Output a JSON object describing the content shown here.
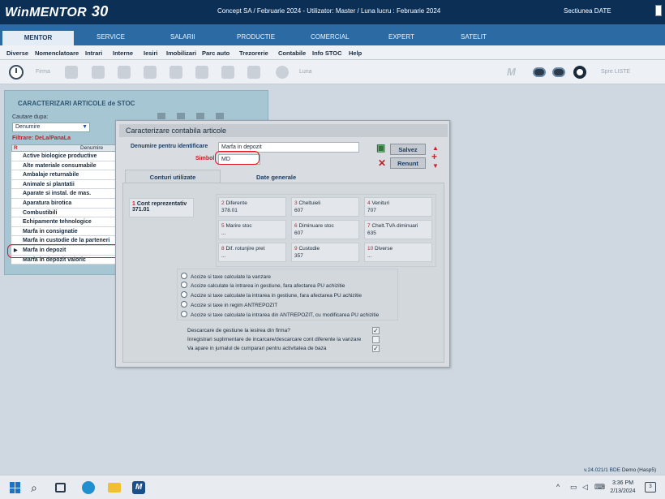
{
  "titlebar": {
    "logo": "WinMENTOR",
    "logo_version": "30",
    "center_text": "Concept SA / Februarie 2024 - Utilizator: Master / Luna lucru : Februarie 2024",
    "right_text": "Sectiunea DATE"
  },
  "module_tabs": [
    "MENTOR",
    "SERVICE",
    "SALARII",
    "PRODUCTIE",
    "COMERCIAL",
    "EXPERT",
    "SATELIT"
  ],
  "menu": [
    "Diverse",
    "Nomenclatoare",
    "Intrari",
    "Interne",
    "Iesiri",
    "Imobilizari",
    "Parc auto",
    "Trezorerie",
    "Contabile",
    "Info STOC",
    "Help"
  ],
  "toolbar": {
    "firma_label": "Firma",
    "luna_label": "Luna",
    "spre_liste_label": "Spre LISTE"
  },
  "bg_window": {
    "title": "CARACTERIZARI ARTICOLE de STOC",
    "search_label": "Cautare dupa:",
    "search_value": "Denumire",
    "filter_label": "Filtrare: DeLa/PanaLa",
    "col_r": "R",
    "col_name": "Denumire",
    "rows": [
      "Active biologice productive",
      "Alte materiale consumabile",
      "Ambalaje returnabile",
      "Animale si plantatii",
      "Aparate si instal. de mas.",
      "Aparatura birotica",
      "Combustibili",
      "Echipamente tehnologice",
      "Marfa in consignatie",
      "Marfa in custodie de la parteneri",
      "Marfa in depozit",
      "Marfa in depozit valoric"
    ]
  },
  "dialog": {
    "title": "Caracterizare contabila articole",
    "name_label": "Denumire pentru identificare",
    "name_value": "Marfa in depozit",
    "symbol_label": "Simbol",
    "symbol_value": "MD",
    "save_label": "Salvez",
    "cancel_label": "Renunt",
    "tab_accounts": "Conturi utilizate",
    "tab_general": "Date generale",
    "main_account": {
      "num": "1",
      "label": "Cont reprezentativ",
      "value": "371.01"
    },
    "accounts": [
      {
        "num": "2",
        "label": "Diferente",
        "value": "378.01"
      },
      {
        "num": "3",
        "label": "Cheltuieli",
        "value": "607"
      },
      {
        "num": "4",
        "label": "Venituri",
        "value": "707"
      },
      {
        "num": "5",
        "label": "Marire stoc",
        "value": "..."
      },
      {
        "num": "6",
        "label": "Diminuare stoc",
        "value": "607"
      },
      {
        "num": "7",
        "label": "Chelt.TVA diminuari",
        "value": "635"
      },
      {
        "num": "8",
        "label": "Dif. rotunjire pret",
        "value": "..."
      },
      {
        "num": "9",
        "label": "Custodie",
        "value": "357"
      },
      {
        "num": "10",
        "label": "Diverse",
        "value": "..."
      }
    ],
    "radios": [
      "Accize si taxe calculate la vanzare",
      "Accize calculate la intrarea in gestiune, fara afectarea PU achizitie",
      "Accize si taxe calculate la intrarea in gestiune, fara afectarea PU achizitie",
      "Accize si taxe in regim ANTREPOZIT",
      "Accize si taxe calculate la intrarea din ANTREPOZIT, cu modificarea PU achizitie"
    ],
    "checkboxes": [
      {
        "label": "Descarcare de gestiune la iesirea din firma?",
        "checked": "✓"
      },
      {
        "label": "Inregistrari suplimentare de incarcare/descarcare cont diferente la vanzare",
        "checked": ""
      },
      {
        "label": "Va apare in jurnalul de cumparari pentru activitatea de baza",
        "checked": "✓"
      }
    ]
  },
  "status": {
    "version": "v.24.021/1 BDE",
    "user": "Demo (Hasp5)"
  },
  "taskbar": {
    "time": "3:36 PM",
    "date": "2/13/2024",
    "notifications": "3"
  },
  "colors": {
    "titlebar": "#0b2f55",
    "module_bar": "#2c6aa3",
    "highlight": "#e0141e",
    "label_blue": "#1b3d63"
  }
}
